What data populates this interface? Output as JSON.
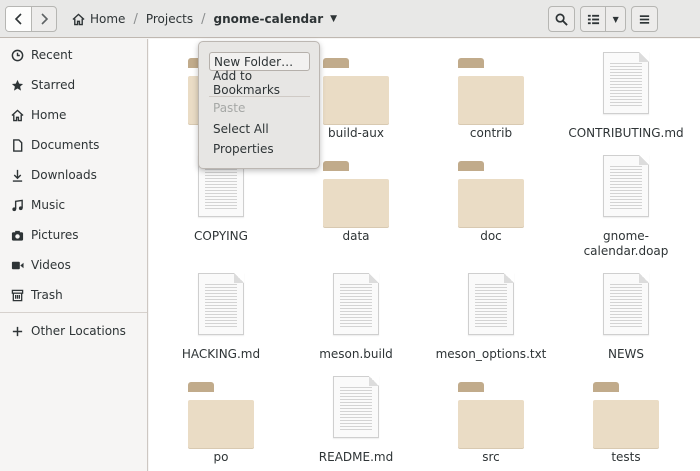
{
  "toolbar": {
    "breadcrumbs": [
      {
        "label": "Home"
      },
      {
        "label": "Projects"
      },
      {
        "label": "gnome-calendar"
      }
    ]
  },
  "sidebar": {
    "items": [
      {
        "label": "Recent",
        "icon": "clock-icon"
      },
      {
        "label": "Starred",
        "icon": "star-icon"
      },
      {
        "label": "Home",
        "icon": "home-icon"
      },
      {
        "label": "Documents",
        "icon": "document-icon"
      },
      {
        "label": "Downloads",
        "icon": "download-icon"
      },
      {
        "label": "Music",
        "icon": "music-icon"
      },
      {
        "label": "Pictures",
        "icon": "camera-icon"
      },
      {
        "label": "Videos",
        "icon": "video-icon"
      },
      {
        "label": "Trash",
        "icon": "trash-icon"
      }
    ],
    "other": {
      "label": "Other Locations",
      "icon": "plus-icon"
    }
  },
  "context_menu": {
    "items": [
      {
        "label": "New Folder…",
        "state": "hover"
      },
      {
        "label": "Add to Bookmarks",
        "state": "normal"
      },
      {
        "label": "Paste",
        "state": "disabled"
      },
      {
        "label": "Select All",
        "state": "normal"
      },
      {
        "label": "Properties",
        "state": "normal"
      }
    ]
  },
  "files": [
    {
      "name": "build-aux",
      "type": "folder"
    },
    {
      "name": "contrib",
      "type": "folder"
    },
    {
      "name": "CONTRIBUTING.md",
      "type": "document"
    },
    {
      "name": "COPYING",
      "type": "document"
    },
    {
      "name": "data",
      "type": "folder"
    },
    {
      "name": "doc",
      "type": "folder"
    },
    {
      "name": "gnome-calendar.doap",
      "type": "document"
    },
    {
      "name": "HACKING.md",
      "type": "document"
    },
    {
      "name": "meson.build",
      "type": "document"
    },
    {
      "name": "meson_options.txt",
      "type": "document"
    },
    {
      "name": "NEWS",
      "type": "document"
    },
    {
      "name": "po",
      "type": "folder"
    },
    {
      "name": "README.md",
      "type": "document"
    },
    {
      "name": "src",
      "type": "folder"
    },
    {
      "name": "tests",
      "type": "folder"
    }
  ]
}
